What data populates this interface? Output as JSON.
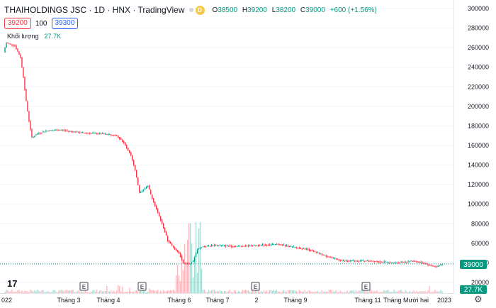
{
  "header": {
    "symbol_title": "THAIHOLDINGS JSC · 1D · HNX · TradingView",
    "delay_badge": "D",
    "open_label": "O",
    "open": "38500",
    "high_label": "H",
    "high": "39200",
    "low_label": "L",
    "low": "38200",
    "close_label": "C",
    "close": "39000",
    "change": "+600 (+1.56%)"
  },
  "order": {
    "sell_price": "39200",
    "quantity": "100",
    "buy_price": "39300"
  },
  "volume_legend": {
    "label": "Khối lượng",
    "value": "27.7K"
  },
  "logo_text": "17",
  "price_scale": {
    "labels": [
      "300000",
      "280000",
      "260000",
      "240000",
      "220000",
      "200000",
      "180000",
      "160000",
      "140000",
      "120000",
      "100000",
      "80000",
      "60000",
      "40000",
      "20000"
    ],
    "current_price": "39000",
    "current_volume": "27.7K"
  },
  "time_scale": {
    "labels": [
      "022",
      "Tháng 3",
      "Tháng 4",
      "Tháng 6",
      "Tháng 7",
      "2",
      "Tháng 9",
      "Tháng 11",
      "Tháng Mười hai",
      "2023"
    ]
  },
  "event_markers": [
    "E",
    "E",
    "E",
    "E"
  ],
  "colors": {
    "up": "#089981",
    "down": "#f23645",
    "grid": "#f0f3fa",
    "last_price_line": "#089981"
  },
  "icons": {
    "settings": "gear-icon",
    "logo": "tradingview-logo-icon"
  },
  "chart_data": {
    "type": "candlestick",
    "ylim": [
      20000,
      300000
    ],
    "price_path": [
      {
        "t": 0,
        "p": 255000
      },
      {
        "t": 2,
        "p": 265000
      },
      {
        "t": 8,
        "p": 262000
      },
      {
        "t": 12,
        "p": 250000
      },
      {
        "t": 14,
        "p": 230000
      },
      {
        "t": 16,
        "p": 205000
      },
      {
        "t": 18,
        "p": 185000
      },
      {
        "t": 20,
        "p": 168000
      },
      {
        "t": 24,
        "p": 172000
      },
      {
        "t": 30,
        "p": 175000
      },
      {
        "t": 40,
        "p": 176000
      },
      {
        "t": 55,
        "p": 173000
      },
      {
        "t": 70,
        "p": 172000
      },
      {
        "t": 80,
        "p": 170000
      },
      {
        "t": 85,
        "p": 163000
      },
      {
        "t": 90,
        "p": 150000
      },
      {
        "t": 93,
        "p": 135000
      },
      {
        "t": 96,
        "p": 112000
      },
      {
        "t": 99,
        "p": 115000
      },
      {
        "t": 102,
        "p": 119000
      },
      {
        "t": 104,
        "p": 110000
      },
      {
        "t": 108,
        "p": 95000
      },
      {
        "t": 112,
        "p": 80000
      },
      {
        "t": 116,
        "p": 63000
      },
      {
        "t": 120,
        "p": 56000
      },
      {
        "t": 124,
        "p": 50000
      },
      {
        "t": 127,
        "p": 40000
      },
      {
        "t": 131,
        "p": 39000
      },
      {
        "t": 134,
        "p": 42000
      },
      {
        "t": 137,
        "p": 54000
      },
      {
        "t": 141,
        "p": 57000
      },
      {
        "t": 150,
        "p": 58000
      },
      {
        "t": 165,
        "p": 57000
      },
      {
        "t": 180,
        "p": 58000
      },
      {
        "t": 195,
        "p": 59000
      },
      {
        "t": 205,
        "p": 56000
      },
      {
        "t": 215,
        "p": 54000
      },
      {
        "t": 222,
        "p": 50000
      },
      {
        "t": 230,
        "p": 46000
      },
      {
        "t": 240,
        "p": 42000
      },
      {
        "t": 260,
        "p": 42000
      },
      {
        "t": 275,
        "p": 40000
      },
      {
        "t": 290,
        "p": 42000
      },
      {
        "t": 296,
        "p": 40000
      },
      {
        "t": 303,
        "p": 37000
      },
      {
        "t": 306,
        "p": 36000
      },
      {
        "t": 310,
        "p": 39000
      }
    ],
    "last": 39000
  }
}
